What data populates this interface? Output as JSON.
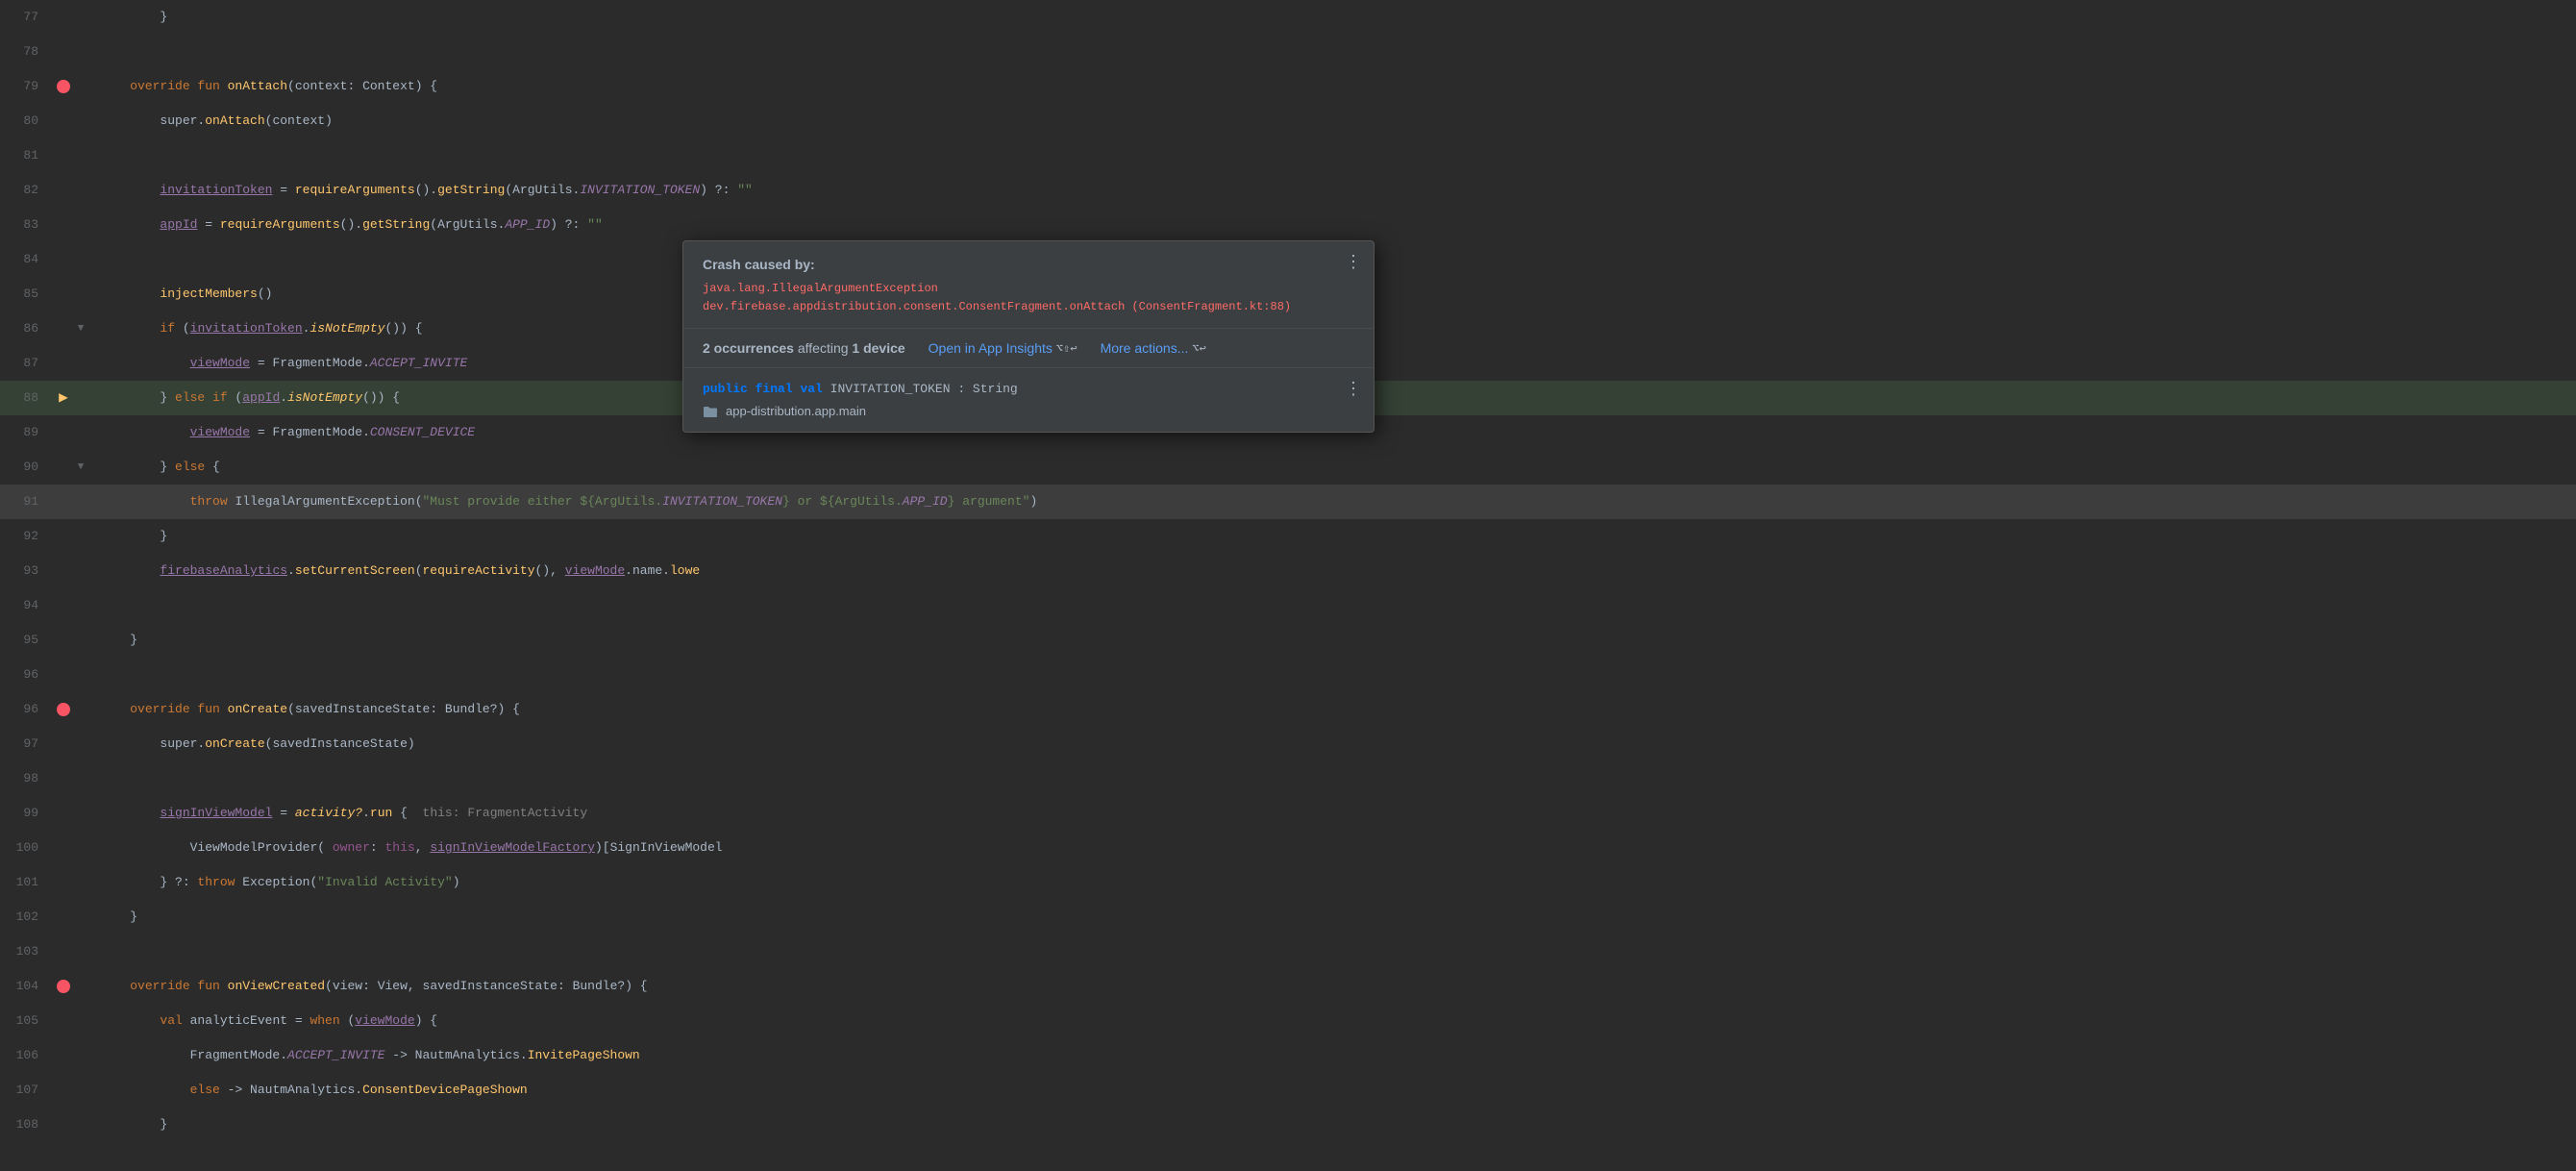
{
  "editor": {
    "topbar_progress_width": "40%",
    "lines": [
      {
        "num": "77",
        "indent": 2,
        "tokens": [
          {
            "t": "bracket",
            "v": "        }"
          }
        ],
        "icons": {
          "left": "",
          "fold": ""
        }
      },
      {
        "num": "78",
        "tokens": [],
        "icons": {
          "left": "",
          "fold": ""
        }
      },
      {
        "num": "79",
        "tokens": [
          {
            "t": "kw",
            "v": "    override fun "
          },
          {
            "t": "fn",
            "v": "onAttach"
          },
          {
            "t": "paren",
            "v": "("
          },
          {
            "t": "param",
            "v": "context"
          },
          {
            "t": "bracket",
            "v": ": "
          },
          {
            "t": "type",
            "v": "Context"
          },
          {
            "t": "bracket",
            "v": ") {"
          }
        ],
        "icons": {
          "left": "breakpoint",
          "fold": ""
        }
      },
      {
        "num": "80",
        "tokens": [
          {
            "t": "var",
            "v": "        super."
          },
          {
            "t": "method",
            "v": "onAttach"
          },
          {
            "t": "paren",
            "v": "("
          },
          {
            "t": "var",
            "v": "context"
          },
          {
            "t": "paren",
            "v": ")"
          }
        ],
        "icons": {
          "left": "",
          "fold": ""
        }
      },
      {
        "num": "81",
        "tokens": [],
        "icons": {
          "left": "",
          "fold": ""
        }
      },
      {
        "num": "82",
        "tokens": [
          {
            "t": "var",
            "v": "        "
          },
          {
            "t": "field-ref",
            "v": "invitationToken"
          },
          {
            "t": "var",
            "v": " = "
          },
          {
            "t": "method",
            "v": "requireArguments"
          },
          {
            "t": "paren",
            "v": "()."
          },
          {
            "t": "method",
            "v": "getString"
          },
          {
            "t": "paren",
            "v": "("
          },
          {
            "t": "var",
            "v": "ArgUtils."
          },
          {
            "t": "const",
            "v": "INVITATION_TOKEN"
          },
          {
            "t": "paren",
            "v": ") ?: "
          },
          {
            "t": "str",
            "v": "\"\""
          }
        ],
        "icons": {
          "left": "",
          "fold": ""
        }
      },
      {
        "num": "83",
        "tokens": [
          {
            "t": "var",
            "v": "        "
          },
          {
            "t": "field-ref",
            "v": "appId"
          },
          {
            "t": "var",
            "v": " = "
          },
          {
            "t": "method",
            "v": "requireArguments"
          },
          {
            "t": "paren",
            "v": "()."
          },
          {
            "t": "method",
            "v": "getString"
          },
          {
            "t": "paren",
            "v": "("
          },
          {
            "t": "var",
            "v": "ArgUtils."
          },
          {
            "t": "const",
            "v": "APP_ID"
          },
          {
            "t": "paren",
            "v": ") ?: "
          },
          {
            "t": "str",
            "v": "\"\""
          }
        ],
        "icons": {
          "left": "",
          "fold": ""
        }
      },
      {
        "num": "84",
        "tokens": [],
        "icons": {
          "left": "",
          "fold": ""
        }
      },
      {
        "num": "85",
        "tokens": [
          {
            "t": "var",
            "v": "        "
          },
          {
            "t": "method",
            "v": "injectMembers"
          },
          {
            "t": "paren",
            "v": "()"
          }
        ],
        "icons": {
          "left": "",
          "fold": ""
        }
      },
      {
        "num": "86",
        "tokens": [
          {
            "t": "var",
            "v": "        "
          },
          {
            "t": "kw",
            "v": "if"
          },
          {
            "t": "var",
            "v": " ("
          },
          {
            "t": "field-ref",
            "v": "invitationToken"
          },
          {
            "t": "var",
            "v": "."
          },
          {
            "t": "italic-method",
            "v": "isNotEmpty"
          },
          {
            "t": "paren",
            "v": "()) {"
          }
        ],
        "icons": {
          "left": "",
          "fold": "fold-open"
        }
      },
      {
        "num": "87",
        "tokens": [
          {
            "t": "var",
            "v": "            "
          },
          {
            "t": "field-ref",
            "v": "viewMode"
          },
          {
            "t": "var",
            "v": " = FragmentMode."
          },
          {
            "t": "const",
            "v": "ACCEPT_INVITE"
          }
        ],
        "icons": {
          "left": "",
          "fold": ""
        }
      },
      {
        "num": "88",
        "tokens": [
          {
            "t": "bracket",
            "v": "        } "
          },
          {
            "t": "kw",
            "v": "else if"
          },
          {
            "t": "var",
            "v": " ("
          },
          {
            "t": "field-ref",
            "v": "appId"
          },
          {
            "t": "var",
            "v": "."
          },
          {
            "t": "italic-method",
            "v": "isNotEmpty"
          },
          {
            "t": "paren",
            "v": "()) {"
          }
        ],
        "icons": {
          "left": "exec-arrow",
          "fold": ""
        },
        "active": true
      },
      {
        "num": "89",
        "tokens": [
          {
            "t": "var",
            "v": "            "
          },
          {
            "t": "field-ref",
            "v": "viewMode"
          },
          {
            "t": "var",
            "v": " = FragmentMode."
          },
          {
            "t": "const",
            "v": "CONSENT_DEVICE"
          }
        ],
        "icons": {
          "left": "",
          "fold": ""
        }
      },
      {
        "num": "90",
        "tokens": [
          {
            "t": "bracket",
            "v": "        } "
          },
          {
            "t": "kw",
            "v": "else"
          },
          {
            "t": "bracket",
            "v": " {"
          }
        ],
        "icons": {
          "left": "",
          "fold": "fold-open"
        }
      },
      {
        "num": "91",
        "tokens": [
          {
            "t": "var",
            "v": "            "
          },
          {
            "t": "kw",
            "v": "throw"
          },
          {
            "t": "var",
            "v": " "
          },
          {
            "t": "type",
            "v": "IllegalArgumentException"
          },
          {
            "t": "paren",
            "v": "("
          },
          {
            "t": "throw-str",
            "v": "\"Must provide either ${ArgUtils."
          },
          {
            "t": "const",
            "v": "INVITATION_TOKEN"
          },
          {
            "t": "throw-str",
            "v": "} or ${ArgUtils."
          },
          {
            "t": "const",
            "v": "APP_ID"
          },
          {
            "t": "throw-str",
            "v": "} argument\""
          },
          {
            "t": "paren",
            "v": ")"
          }
        ],
        "icons": {
          "left": "",
          "fold": ""
        }
      },
      {
        "num": "92",
        "tokens": [
          {
            "t": "bracket",
            "v": "        }"
          }
        ],
        "icons": {
          "left": "",
          "fold": ""
        }
      },
      {
        "num": "93",
        "tokens": [
          {
            "t": "var",
            "v": "        "
          },
          {
            "t": "field-ref",
            "v": "firebaseAnalytics"
          },
          {
            "t": "var",
            "v": "."
          },
          {
            "t": "method",
            "v": "setCurrentScreen"
          },
          {
            "t": "paren",
            "v": "("
          },
          {
            "t": "method",
            "v": "requireActivity"
          },
          {
            "t": "paren",
            "v": "(), "
          },
          {
            "t": "field-ref",
            "v": "viewMode"
          },
          {
            "t": "var",
            "v": ".name."
          },
          {
            "t": "method",
            "v": "lowe"
          }
        ],
        "icons": {
          "left": "",
          "fold": ""
        }
      },
      {
        "num": "94",
        "tokens": [],
        "icons": {
          "left": "",
          "fold": ""
        }
      },
      {
        "num": "95",
        "tokens": [
          {
            "t": "bracket",
            "v": "    }"
          }
        ],
        "icons": {
          "left": "",
          "fold": ""
        }
      },
      {
        "num": "96",
        "tokens": [],
        "icons": {
          "left": "",
          "fold": ""
        }
      },
      {
        "num": "96b",
        "tokens": [
          {
            "t": "var",
            "v": "    "
          },
          {
            "t": "kw",
            "v": "override fun "
          },
          {
            "t": "fn",
            "v": "onCreate"
          },
          {
            "t": "paren",
            "v": "("
          },
          {
            "t": "param",
            "v": "savedInstanceState"
          },
          {
            "t": "bracket",
            "v": ": "
          },
          {
            "t": "type",
            "v": "Bundle?"
          },
          {
            "t": "bracket",
            "v": ") {"
          }
        ],
        "icons": {
          "left": "breakpoint",
          "fold": ""
        }
      },
      {
        "num": "97",
        "tokens": [
          {
            "t": "var",
            "v": "        super."
          },
          {
            "t": "method",
            "v": "onCreate"
          },
          {
            "t": "paren",
            "v": "("
          },
          {
            "t": "var",
            "v": "savedInstanceState"
          },
          {
            "t": "paren",
            "v": ")"
          }
        ],
        "icons": {
          "left": "",
          "fold": ""
        }
      },
      {
        "num": "98",
        "tokens": [],
        "icons": {
          "left": "",
          "fold": ""
        }
      },
      {
        "num": "99",
        "tokens": [
          {
            "t": "var",
            "v": "        "
          },
          {
            "t": "field-ref",
            "v": "signInViewModel"
          },
          {
            "t": "var",
            "v": " = "
          },
          {
            "t": "italic-method",
            "v": "activity?"
          },
          {
            "t": "var",
            "v": "."
          },
          {
            "t": "method",
            "v": "run"
          },
          {
            "t": "bracket",
            "v": " {  "
          },
          {
            "t": "comment",
            "v": "this: FragmentActivity"
          }
        ],
        "icons": {
          "left": "",
          "fold": ""
        }
      },
      {
        "num": "100",
        "tokens": [
          {
            "t": "var",
            "v": "            "
          },
          {
            "t": "type",
            "v": "ViewModelProvider"
          },
          {
            "t": "paren",
            "v": "( "
          },
          {
            "t": "this-keyword",
            "v": "owner"
          },
          {
            "t": "paren",
            "v": ": "
          },
          {
            "t": "this-keyword",
            "v": "this"
          },
          {
            "t": "paren",
            "v": ", "
          },
          {
            "t": "field-ref",
            "v": "signInViewModelFactory"
          },
          {
            "t": "paren",
            "v": ")["
          },
          {
            "t": "type",
            "v": "SignInViewModel"
          }
        ],
        "icons": {
          "left": "",
          "fold": ""
        }
      },
      {
        "num": "101",
        "tokens": [
          {
            "t": "var",
            "v": "        } ?: "
          },
          {
            "t": "kw",
            "v": "throw"
          },
          {
            "t": "var",
            "v": " "
          },
          {
            "t": "type",
            "v": "Exception"
          },
          {
            "t": "paren",
            "v": "("
          },
          {
            "t": "str",
            "v": "\"Invalid Activity\""
          },
          {
            "t": "paren",
            "v": ")"
          }
        ],
        "icons": {
          "left": "",
          "fold": ""
        }
      },
      {
        "num": "102",
        "tokens": [
          {
            "t": "bracket",
            "v": "    }"
          }
        ],
        "icons": {
          "left": "",
          "fold": ""
        }
      },
      {
        "num": "103",
        "tokens": [],
        "icons": {
          "left": "",
          "fold": ""
        }
      },
      {
        "num": "104",
        "tokens": [
          {
            "t": "var",
            "v": "    "
          },
          {
            "t": "kw",
            "v": "override fun "
          },
          {
            "t": "fn",
            "v": "onViewCreated"
          },
          {
            "t": "paren",
            "v": "("
          },
          {
            "t": "param",
            "v": "view"
          },
          {
            "t": "bracket",
            "v": ": "
          },
          {
            "t": "type",
            "v": "View"
          },
          {
            "t": "paren",
            "v": ", "
          },
          {
            "t": "param",
            "v": "savedInstanceState"
          },
          {
            "t": "bracket",
            "v": ": "
          },
          {
            "t": "type",
            "v": "Bundle?"
          },
          {
            "t": "bracket",
            "v": ") {"
          }
        ],
        "icons": {
          "left": "breakpoint",
          "fold": ""
        }
      },
      {
        "num": "105",
        "tokens": [
          {
            "t": "var",
            "v": "        "
          },
          {
            "t": "kw",
            "v": "val"
          },
          {
            "t": "var",
            "v": " analyticEvent = "
          },
          {
            "t": "kw",
            "v": "when"
          },
          {
            "t": "var",
            "v": " ("
          },
          {
            "t": "field-ref",
            "v": "viewMode"
          },
          {
            "t": "bracket",
            "v": ") {"
          }
        ],
        "icons": {
          "left": "",
          "fold": ""
        }
      },
      {
        "num": "106",
        "tokens": [
          {
            "t": "var",
            "v": "            FragmentMode."
          },
          {
            "t": "const",
            "v": "ACCEPT_INVITE"
          },
          {
            "t": "var",
            "v": " -> NautmAnalytics."
          },
          {
            "t": "method",
            "v": "InvitePageShown"
          }
        ],
        "icons": {
          "left": "",
          "fold": ""
        }
      },
      {
        "num": "107",
        "tokens": [
          {
            "t": "var",
            "v": "            "
          },
          {
            "t": "kw",
            "v": "else"
          },
          {
            "t": "var",
            "v": " -> NautmAnalytics."
          },
          {
            "t": "method",
            "v": "ConsentDevicePageShown"
          }
        ],
        "icons": {
          "left": "",
          "fold": ""
        }
      },
      {
        "num": "108",
        "tokens": [
          {
            "t": "bracket",
            "v": "        }"
          }
        ],
        "icons": {
          "left": "",
          "fold": ""
        }
      }
    ]
  },
  "popup": {
    "crash_title": "Crash caused by:",
    "exception_line1": "java.lang.IllegalArgumentException",
    "exception_line2": "dev.firebase.appdistribution.consent.ConsentFragment.onAttach (ConsentFragment.kt:88)",
    "occurrences": "2 occurrences",
    "affecting": "affecting",
    "device_count": "1 device",
    "open_insights_label": "Open in App Insights",
    "open_insights_shortcut": "⌥⇧↩",
    "more_actions_label": "More actions...",
    "more_actions_shortcut": "⌥↩",
    "code_line": "public final val INVITATION_TOKEN: String",
    "file_label": "app-distribution.app.main",
    "more_btn_top": "⋮",
    "more_btn_bottom": "⋮"
  }
}
